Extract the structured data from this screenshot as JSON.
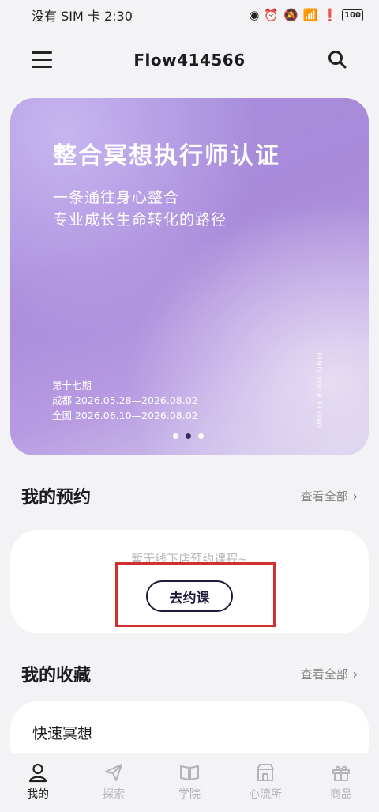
{
  "status_bar": {
    "carrier_time": "没有 SIM 卡 2:30",
    "battery": "100"
  },
  "header": {
    "title": "Flow414566",
    "menu_icon": "hamburger-menu-icon",
    "search_icon": "search-icon"
  },
  "banner": {
    "title": "整合冥想执行师认证",
    "subtitle_lines": [
      "一条通往身心整合",
      "专业成长生命转化的路径"
    ],
    "info_lines": [
      "第十七期",
      "成都 2026.05.28—2026.08.02",
      "全国 2026.06.10—2026.08.02"
    ],
    "side_text": "FIND YOUR FLOW!",
    "carousel": {
      "count": 3,
      "active_index": 1
    }
  },
  "my_reservations": {
    "title": "我的预约",
    "view_all": "查看全部",
    "empty_text": "暂无线下店预约课程~",
    "book_button": "去约课"
  },
  "my_favorites": {
    "title": "我的收藏",
    "view_all": "查看全部",
    "items": [
      "快速冥想"
    ]
  },
  "bottom_nav": {
    "items": [
      {
        "label": "我的",
        "icon": "user-icon",
        "active": true
      },
      {
        "label": "探索",
        "icon": "paper-plane-icon",
        "active": false
      },
      {
        "label": "学院",
        "icon": "book-icon",
        "active": false
      },
      {
        "label": "心流所",
        "icon": "store-icon",
        "active": false
      },
      {
        "label": "商品",
        "icon": "gift-icon",
        "active": false
      }
    ]
  },
  "colors": {
    "accent_dark": "#1f1a3a",
    "highlight_red": "#d32f2f",
    "banner_purple": "#a88ad9"
  }
}
